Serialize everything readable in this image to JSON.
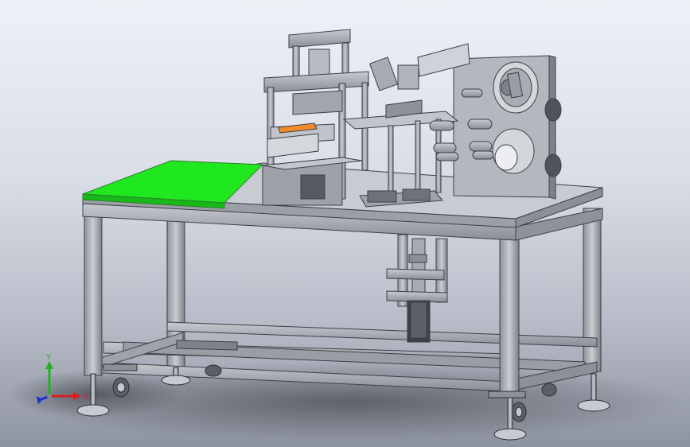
{
  "view": {
    "background_top": "#eef1f7",
    "background_bottom": "#8d939f",
    "highlight_color": "#1fe81f"
  },
  "triad": {
    "x_label": "X",
    "y_label": "Y",
    "z_label": "",
    "x_color": "#d61f1f",
    "y_color": "#1fb31f",
    "z_color": "#1f2fd6"
  },
  "model": {
    "components": [
      "table-frame",
      "table-top",
      "green-work-plate",
      "upper-press-tower",
      "tape-feeder-plate",
      "feed-rollers",
      "lower-lift-cylinder",
      "caster-wheels",
      "leveling-feet"
    ]
  }
}
